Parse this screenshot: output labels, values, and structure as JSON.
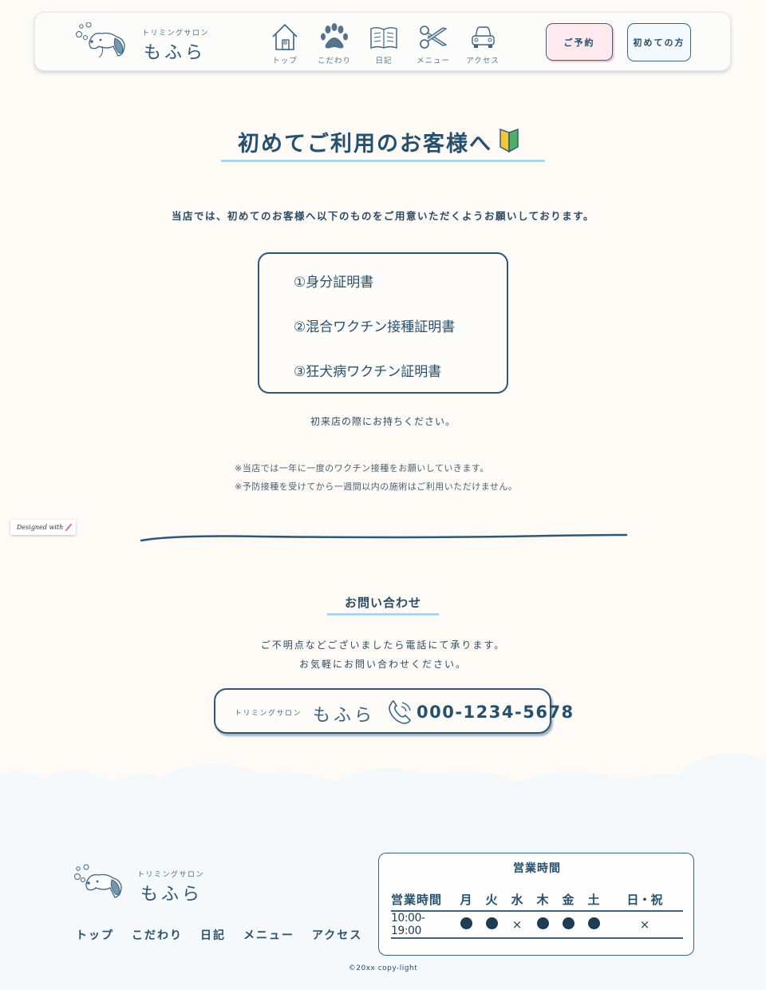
{
  "header": {
    "logo_sub": "トリミングサロン",
    "logo_main": "もふら",
    "nav": [
      {
        "label": "トップ",
        "icon": "house-icon"
      },
      {
        "label": "こだわり",
        "icon": "paw-icon"
      },
      {
        "label": "日記",
        "icon": "book-icon"
      },
      {
        "label": "メニュー",
        "icon": "scissors-icon"
      },
      {
        "label": "アクセス",
        "icon": "car-icon"
      }
    ],
    "reserve_label": "ご予約",
    "first_label": "初めての方"
  },
  "intro": {
    "title": "初めてご利用のお客様へ",
    "lead": "当店では、初めてのお客様へ以下のものをご用意いただくようお願いしております。",
    "documents": [
      "①身分証明書",
      "②混合ワクチン接種証明書",
      "③狂犬病ワクチン証明書"
    ],
    "bring": "初来店の際にお持ちください。",
    "notes": [
      "※当店では一年に一度のワクチン接種をお願いしていきます。",
      "※予防接種を受けてから一週間以内の施術はご利用いただけません。"
    ]
  },
  "badge": "Designed with",
  "contact": {
    "title": "お問い合わせ",
    "text": [
      "ご不明点などございましたら電話にて承ります。",
      "お気軽にお問い合わせください。"
    ],
    "salon_sub": "トリミングサロン",
    "salon_name": "もふら",
    "phone": "000-1234-5678"
  },
  "footer": {
    "logo_sub": "トリミングサロン",
    "logo_main": "もふら",
    "nav": [
      "トップ",
      "こだわり",
      "日記",
      "メニュー",
      "アクセス"
    ],
    "hours_title": "営業時間",
    "hours_header": [
      "営業時間",
      "月",
      "火",
      "水",
      "木",
      "金",
      "土",
      "日・祝"
    ],
    "hours_time": "10:00-19:00",
    "hours_status": [
      "open",
      "open",
      "closed",
      "open",
      "open",
      "open",
      "closed"
    ],
    "copyright": "©20xx copy-light"
  },
  "colors": {
    "navy": "#27506e",
    "background": "#fefbf6",
    "accent_blue": "#aad7f0",
    "reserve_pink": "#fde9ee",
    "footer_sky": "#f5f9fc"
  }
}
